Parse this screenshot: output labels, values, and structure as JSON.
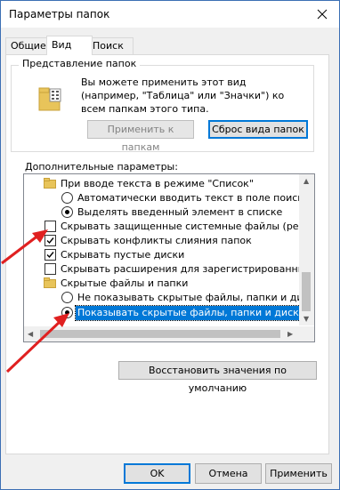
{
  "window": {
    "title": "Параметры папок"
  },
  "tabs": [
    {
      "label": "Общие"
    },
    {
      "label": "Вид"
    },
    {
      "label": "Поиск"
    }
  ],
  "folder_view": {
    "group_label": "Представление папок",
    "description": "Вы можете применить этот вид (например, \"Таблица\" или \"Значки\") ко всем папкам этого типа.",
    "apply_button": "Применить к папкам",
    "reset_button": "Сброс вида папок"
  },
  "advanced": {
    "label": "Дополнительные параметры:",
    "items": [
      {
        "type": "folder",
        "label": "При вводе текста в режиме \"Список\""
      },
      {
        "type": "radio",
        "checked": false,
        "label": "Автоматически вводить текст в поле поиска"
      },
      {
        "type": "radio",
        "checked": true,
        "label": "Выделять введенный элемент в списке"
      },
      {
        "type": "checkbox",
        "checked": false,
        "label": "Скрывать защищенные системные файлы (рекомен."
      },
      {
        "type": "checkbox",
        "checked": true,
        "label": "Скрывать конфликты слияния папок"
      },
      {
        "type": "checkbox",
        "checked": true,
        "label": "Скрывать пустые диски"
      },
      {
        "type": "checkbox",
        "checked": false,
        "label": "Скрывать расширения для зарегистрированных типо"
      },
      {
        "type": "folder",
        "label": "Скрытые файлы и папки"
      },
      {
        "type": "radio",
        "checked": false,
        "label": "Не показывать скрытые файлы, папки и диски"
      },
      {
        "type": "radio",
        "checked": true,
        "selected": true,
        "label": "Показывать скрытые файлы, папки и диски"
      }
    ]
  },
  "restore_button": "Восстановить значения по умолчанию",
  "footer": {
    "ok": "OK",
    "cancel": "Отмена",
    "apply": "Применить"
  },
  "colors": {
    "accent": "#0078d7",
    "annotation_arrow": "#e02020"
  },
  "icons": [
    "close-icon",
    "folder-icon",
    "checkbox-icon",
    "radio-icon",
    "scroll-arrow-icon",
    "red-arrow-annotation"
  ]
}
